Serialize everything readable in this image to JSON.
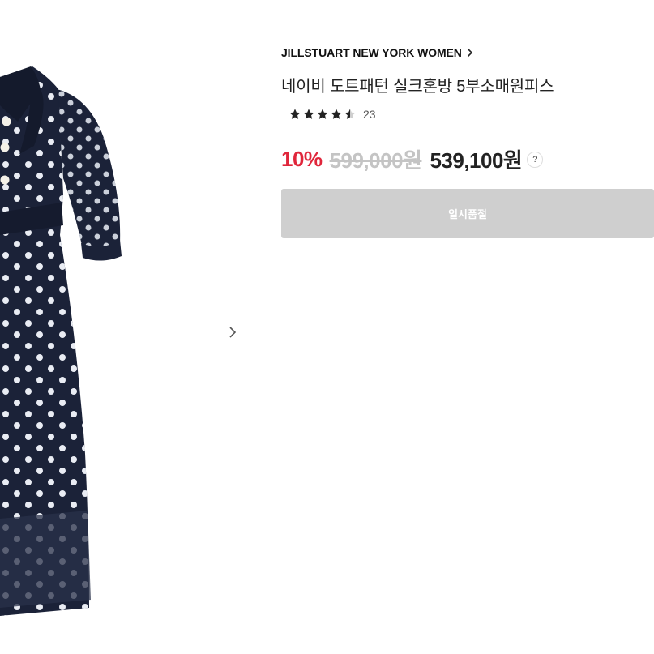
{
  "product": {
    "brand": "JILLSTUART NEW YORK WOMEN",
    "title": "네이비 도트패턴 실크혼방 5부소매원피스",
    "rating": {
      "stars": 4.5,
      "review_count": "23"
    },
    "price": {
      "discount": "10%",
      "original": "599,000원",
      "final": "539,100원",
      "help_label": "?"
    },
    "button_label": "일시품절"
  },
  "image": {
    "description_icon": "next-arrow-icon"
  },
  "colors": {
    "accent_discount": "#e0263b",
    "dress_navy": "#1b2238",
    "button_disabled": "#cfcfcf"
  }
}
